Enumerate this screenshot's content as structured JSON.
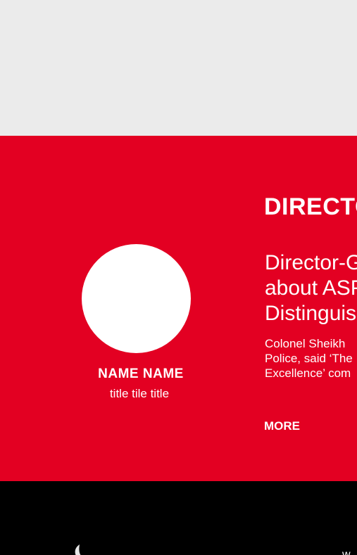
{
  "director_section": {
    "section_title": "DIRECTOR-GENERAL'S MESSAGE",
    "person": {
      "name": "NAME NAME",
      "title": "title tile title"
    },
    "headline_lines": [
      "Director-General talks",
      "about ASP and the",
      "Distinguished Performance"
    ],
    "excerpt_lines": [
      "Colonel Sheikh",
      "Police, said ‘The",
      "Excellence’ com"
    ],
    "more_label": "MORE"
  },
  "footer": {
    "corner_text": "w"
  },
  "colors": {
    "accent_red": "#e30022",
    "footer_black": "#000000",
    "page_gray": "#ebebeb"
  }
}
